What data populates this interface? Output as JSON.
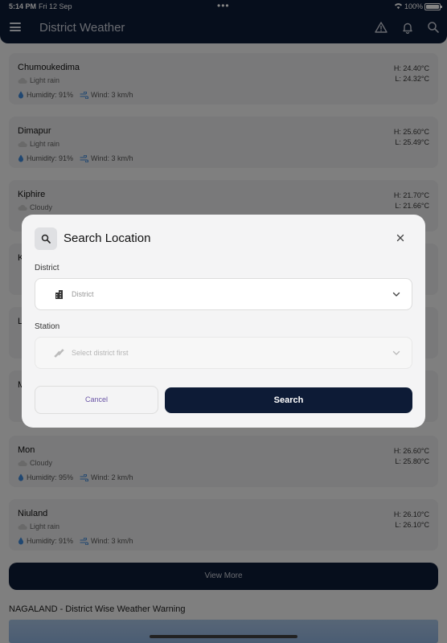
{
  "status_bar": {
    "time": "5:14 PM",
    "date": "Fri 12 Sep",
    "battery": "100%"
  },
  "header": {
    "title": "District Weather"
  },
  "cards": [
    {
      "name": "Chumoukedima",
      "condition": "Light rain",
      "humidity": "Humidity: 91%",
      "wind": "Wind: 3 km/h",
      "high": "H: 24.40°C",
      "low": "L: 24.32°C"
    },
    {
      "name": "Dimapur",
      "condition": "Light rain",
      "humidity": "Humidity: 91%",
      "wind": "Wind: 3 km/h",
      "high": "H: 25.60°C",
      "low": "L: 25.49°C"
    },
    {
      "name": "Kiphire",
      "condition": "Cloudy",
      "humidity": "",
      "wind": "",
      "high": "H: 21.70°C",
      "low": "L: 21.66°C"
    },
    {
      "name": "K",
      "condition": "",
      "humidity": "",
      "wind": "",
      "high": "",
      "low": ""
    },
    {
      "name": "L",
      "condition": "",
      "humidity": "",
      "wind": "",
      "high": "",
      "low": ""
    },
    {
      "name": "M",
      "condition": "",
      "humidity": "",
      "wind": "",
      "high": "",
      "low": ""
    },
    {
      "name": "Mon",
      "condition": "Cloudy",
      "humidity": "Humidity: 95%",
      "wind": "Wind: 2 km/h",
      "high": "H: 26.60°C",
      "low": "L: 25.80°C"
    },
    {
      "name": "Niuland",
      "condition": "Light rain",
      "humidity": "Humidity: 91%",
      "wind": "Wind: 3 km/h",
      "high": "H: 26.10°C",
      "low": "L: 26.10°C"
    }
  ],
  "view_more_label": "View More",
  "warning_title": "NAGALAND - District Wise Weather Warning",
  "dialog": {
    "title": "Search Location",
    "district_label": "District",
    "district_placeholder": "District",
    "station_label": "Station",
    "station_placeholder": "Select district first",
    "cancel_label": "Cancel",
    "search_label": "Search"
  },
  "colors": {
    "navy": "#0d1b36",
    "accent_purple": "#6a55a6"
  }
}
